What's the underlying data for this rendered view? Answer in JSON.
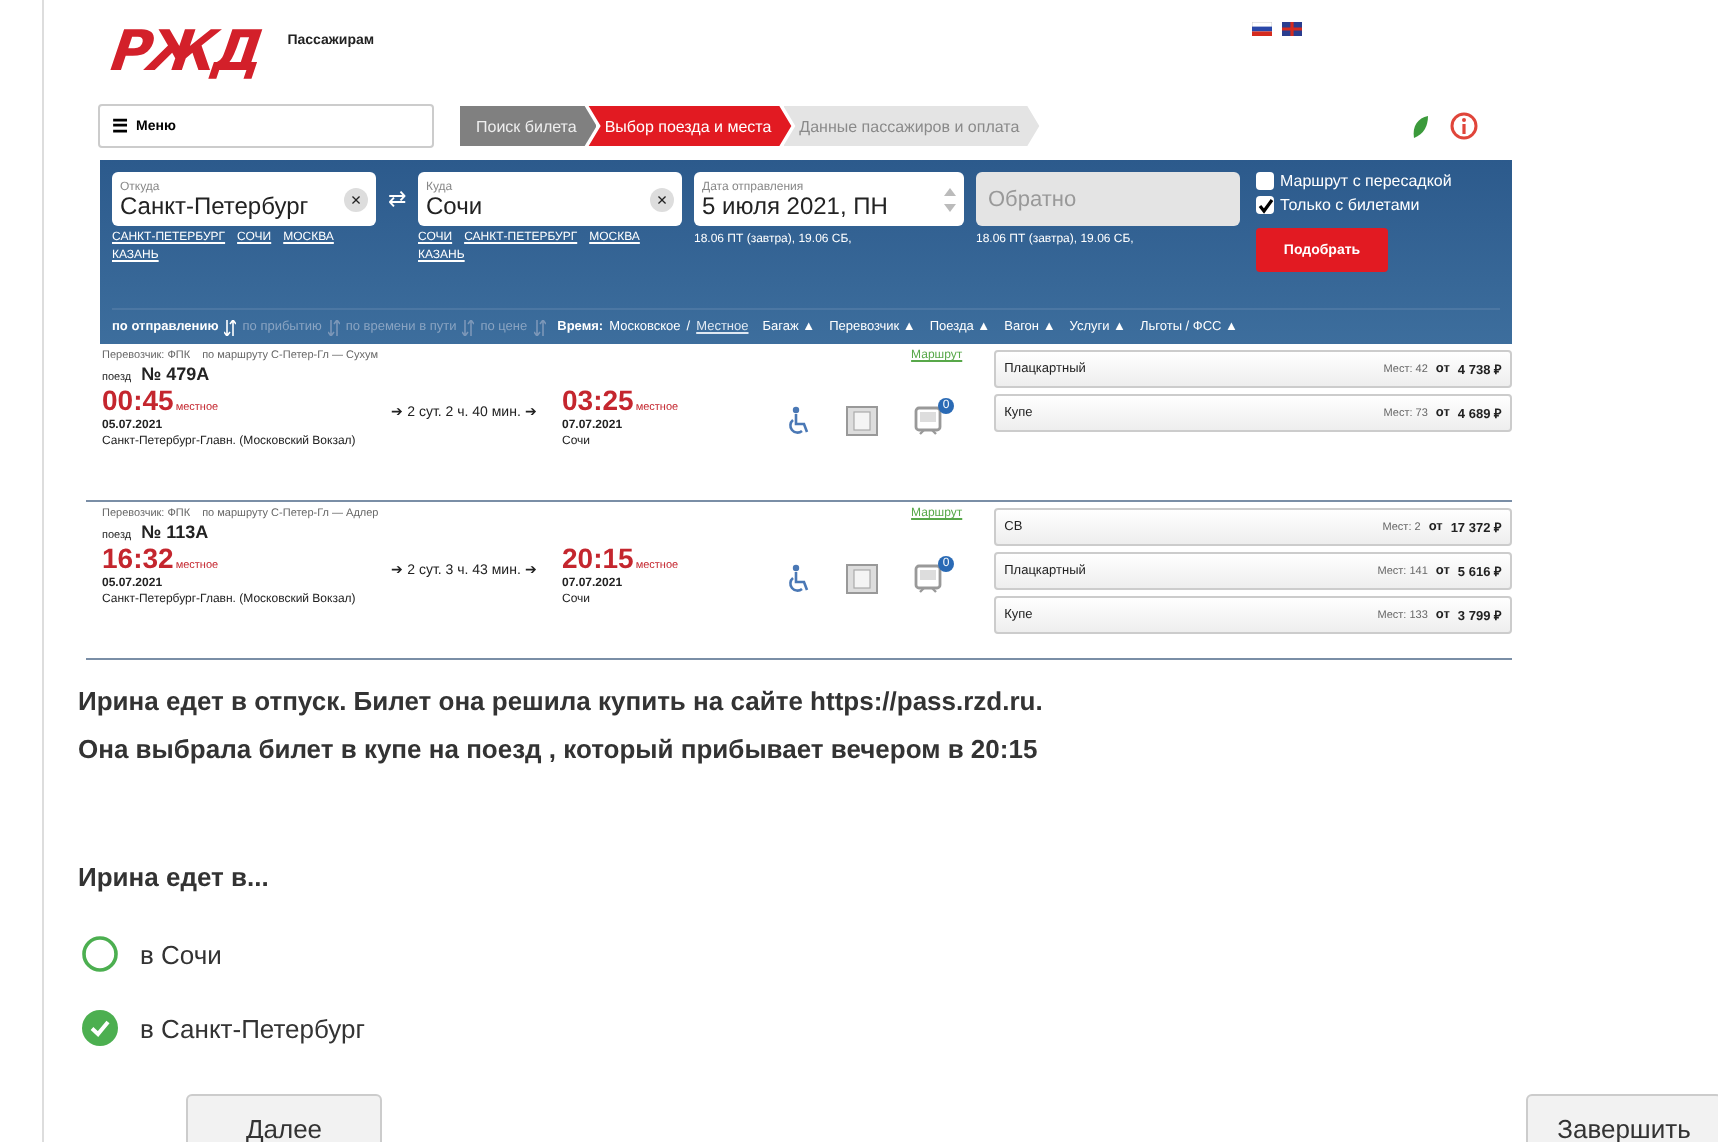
{
  "site": {
    "logo": "РЖД",
    "section": "Пассажирам",
    "menu": {
      "icon": "☰",
      "label": "Меню"
    },
    "steps": [
      {
        "label": "Поиск билета",
        "kind": "done"
      },
      {
        "label": "Выбор поезда и места",
        "kind": "current"
      },
      {
        "label": "Данные пассажиров и оплата",
        "kind": "upcoming"
      }
    ],
    "search": {
      "from": {
        "label": "Откуда",
        "value": "Санкт-Петербург",
        "clear": "×",
        "suggestions": [
          "САНКТ-ПЕТЕРБУРГ",
          "СОЧИ",
          "МОСКВА",
          "КАЗАНЬ"
        ]
      },
      "swap": "⇄",
      "to": {
        "label": "Куда",
        "value": "Сочи",
        "clear": "×",
        "suggestions": [
          "СОЧИ",
          "САНКТ-ПЕТЕРБУРГ",
          "МОСКВА",
          "КАЗАНЬ"
        ]
      },
      "date": {
        "label": "Дата отправления",
        "value": "5 июля 2021, ПН",
        "hint": "18.06 ПТ (завтра), 19.06 СБ,"
      },
      "return": {
        "placeholder": "Обратно",
        "disabled": true,
        "hint": "18.06 ПТ (завтра), 19.06 СБ,"
      },
      "options": [
        {
          "label": "Маршрут с пересадкой",
          "checked": false
        },
        {
          "label": "Только с билетами",
          "checked": true
        }
      ],
      "button": "Подобрать"
    },
    "sort": [
      {
        "label": "по отправлению",
        "selected": true
      },
      {
        "label": "по прибытию",
        "selected": false
      },
      {
        "label": "по времени в пути",
        "selected": false
      },
      {
        "label": "по цене",
        "selected": false
      }
    ],
    "time": {
      "label": "Время:",
      "options": [
        {
          "label": "Московское",
          "selected": true
        },
        {
          "label": "Местное",
          "selected": false
        }
      ],
      "separator": "/"
    },
    "filters": [
      "Багаж ▲",
      "Перевозчик ▲",
      "Поезда ▲",
      "Вагон ▲",
      "Услуги ▲",
      "Льготы / ФСС ▲"
    ],
    "trains": [
      {
        "carrier": "Перевозчик: ФПК",
        "route": "по маршруту С-Петер-Гл — Сухум",
        "train_label": "поезд",
        "number": "№ 479А",
        "route_link": "Маршрут",
        "departure": {
          "time": "00:45",
          "zone": "местное",
          "date": "05.07.2021",
          "station": "Санкт-Петербург-Главн. (Московский Вокзал)"
        },
        "duration": "➔ 2 сут. 2 ч. 40 мин. ➔",
        "arrival": {
          "time": "03:25",
          "zone": "местное",
          "date": "07.07.2021",
          "station": "Сочи"
        },
        "badge": "0",
        "cars": [
          {
            "type": "Плацкартный",
            "seats": "Мест: 42",
            "from": "от",
            "price": "4 738 ₽"
          },
          {
            "type": "Купе",
            "seats": "Мест: 73",
            "from": "от",
            "price": "4 689 ₽"
          }
        ]
      },
      {
        "carrier": "Перевозчик: ФПК",
        "route": "по маршруту С-Петер-Гл — Адлер",
        "train_label": "поезд",
        "number": "№ 113А",
        "route_link": "Маршрут",
        "departure": {
          "time": "16:32",
          "zone": "местное",
          "date": "05.07.2021",
          "station": "Санкт-Петербург-Главн. (Московский Вокзал)"
        },
        "duration": "➔ 2 сут. 3 ч. 43 мин. ➔",
        "arrival": {
          "time": "20:15",
          "zone": "местное",
          "date": "07.07.2021",
          "station": "Сочи"
        },
        "badge": "0",
        "cars": [
          {
            "type": "СВ",
            "seats": "Мест: 2",
            "from": "от",
            "price": "17 372 ₽"
          },
          {
            "type": "Плацкартный",
            "seats": "Мест: 141",
            "from": "от",
            "price": "5 616 ₽"
          },
          {
            "type": "Купе",
            "seats": "Мест: 133",
            "from": "от",
            "price": "3 799 ₽"
          }
        ]
      }
    ]
  },
  "quiz": {
    "paragraphs": [
      "Ирина едет в отпуск. Билет она решила купить на сайте  https://pass.rzd.ru.",
      "Она выбрала билет в купе на поезд , который прибывает вечером в 20:15"
    ],
    "question": "Ирина едет в...",
    "answers": [
      {
        "label": "в Сочи",
        "selected": false
      },
      {
        "label": "в Санкт-Петербург",
        "selected": true
      }
    ],
    "buttons": [
      {
        "label": "Далее",
        "kind": "next"
      },
      {
        "label": "Завершить",
        "kind": "finish"
      }
    ]
  }
}
